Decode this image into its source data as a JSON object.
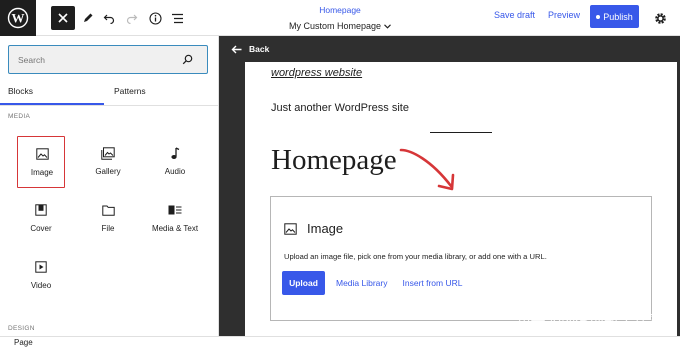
{
  "topbar": {
    "logo_icon": "wordpress-logo-icon",
    "tools": [
      "close-icon",
      "pencil-icon",
      "undo-icon",
      "redo-icon",
      "info-icon",
      "list-view-icon"
    ],
    "document": {
      "template": "Homepage",
      "title": "My Custom Homepage"
    },
    "save_draft": "Save draft",
    "preview": "Preview",
    "publish": "Publish",
    "settings_icon": "gear-icon",
    "accent": "#3858e9"
  },
  "inserter": {
    "search": {
      "placeholder": "Search",
      "value": ""
    },
    "tabs": [
      {
        "label": "Blocks",
        "active": true
      },
      {
        "label": "Patterns",
        "active": false
      }
    ],
    "categories": [
      {
        "label": "MEDIA",
        "blocks": [
          {
            "label": "Image",
            "icon": "image-icon",
            "selected": true
          },
          {
            "label": "Gallery",
            "icon": "gallery-icon",
            "selected": false
          },
          {
            "label": "Audio",
            "icon": "music-note-icon",
            "selected": false
          },
          {
            "label": "Cover",
            "icon": "cover-icon",
            "selected": false
          },
          {
            "label": "File",
            "icon": "folder-icon",
            "selected": false
          },
          {
            "label": "Media & Text",
            "icon": "media-text-icon",
            "selected": false
          },
          {
            "label": "Video",
            "icon": "video-icon",
            "selected": false
          }
        ]
      },
      {
        "label": "DESIGN",
        "blocks": []
      }
    ]
  },
  "canvas": {
    "back": "Back",
    "site_title": "wordpress website",
    "tagline": "Just another WordPress site",
    "heading": "Homepage",
    "image_block": {
      "title": "Image",
      "description": "Upload an image file, pick one from your media library, or add one with a URL.",
      "upload": "Upload",
      "media_library": "Media Library",
      "insert_from_url": "Insert from URL"
    },
    "watermark": "知乎 @WP创新工作室",
    "annotation_color": "#d63638"
  },
  "footer": {
    "breadcrumb": "Page"
  }
}
